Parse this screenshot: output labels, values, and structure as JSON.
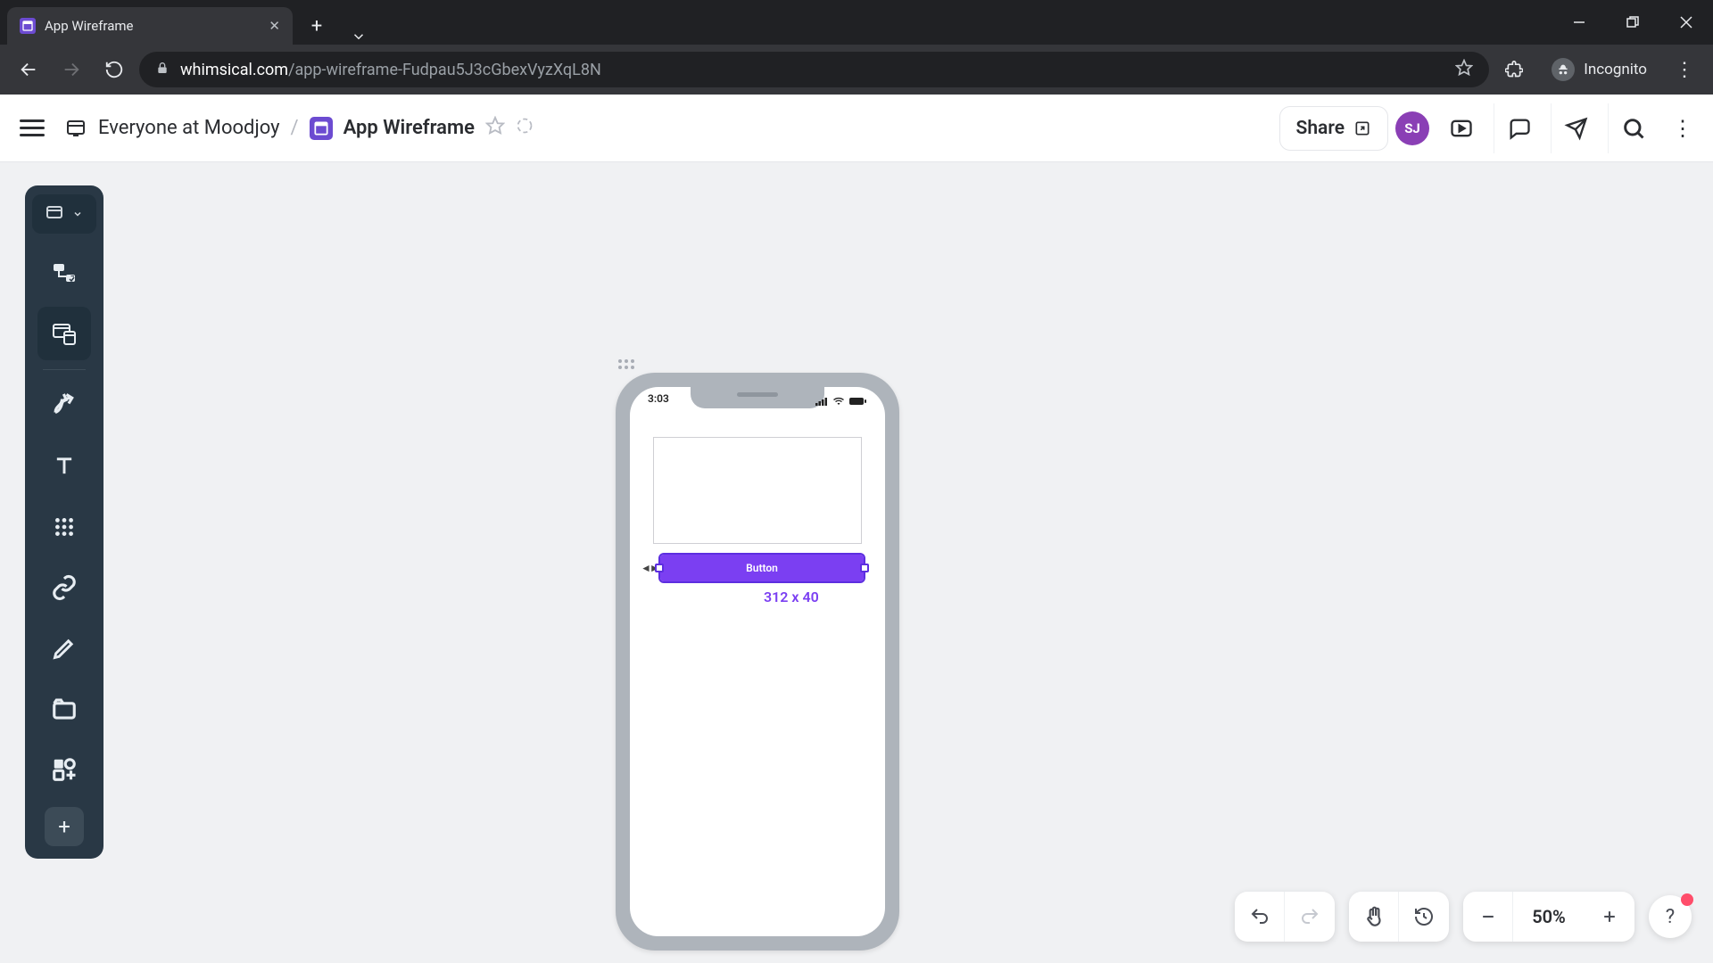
{
  "browser": {
    "tab_title": "App Wireframe",
    "url_host": "whimsical.com",
    "url_path": "/app-wireframe-Fudpau5J3cGbexVyzXqL8N",
    "incognito_label": "Incognito"
  },
  "header": {
    "workspace": "Everyone at Moodjoy",
    "separator": "/",
    "doc_name": "App Wireframe",
    "share_label": "Share",
    "avatar_initials": "SJ"
  },
  "canvas": {
    "status_time": "3:03",
    "button_label": "Button",
    "selection_dimensions": "312 x 40"
  },
  "bottom": {
    "zoom_label": "50%"
  }
}
